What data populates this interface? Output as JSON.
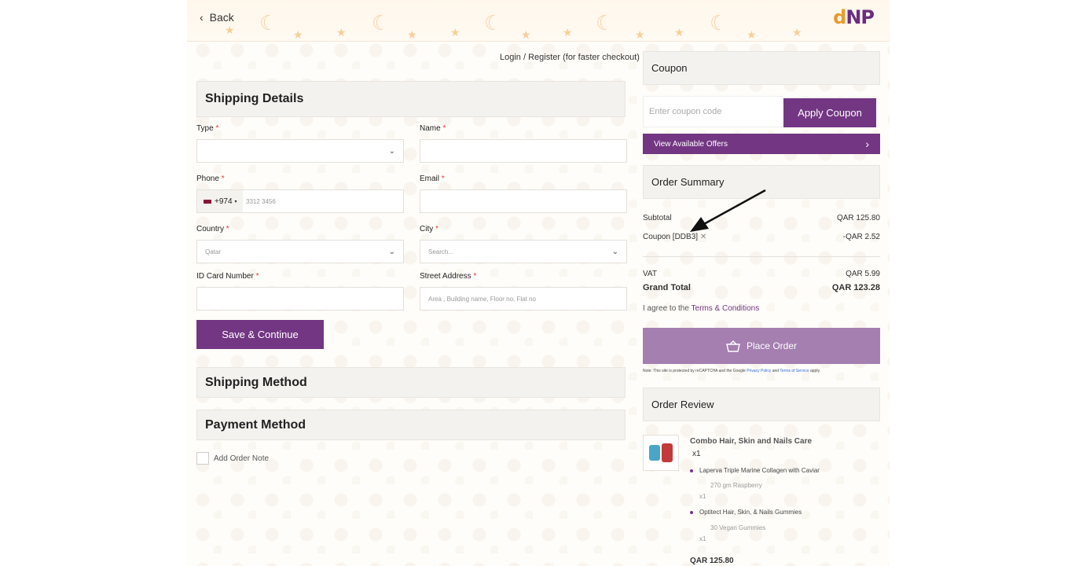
{
  "header": {
    "back_label": "Back",
    "logo_text": "dNP",
    "login_link": "Login / Register (for faster checkout)"
  },
  "shipping": {
    "title": "Shipping Details",
    "fields": {
      "type_label": "Type",
      "name_label": "Name",
      "phone_label": "Phone",
      "phone_code": "+974",
      "phone_placeholder": "3312 3456",
      "email_label": "Email",
      "country_label": "Country",
      "country_value": "Qatar",
      "city_label": "City",
      "city_placeholder": "Search...",
      "id_label": "ID Card Number",
      "street_label": "Street Address",
      "street_placeholder": "Area , Building name, Floor no, Flat no"
    },
    "required_mark": "*",
    "save_button": "Save & Continue"
  },
  "shipping_method_title": "Shipping Method",
  "payment_method_title": "Payment Method",
  "order_note_label": "Add Order Note",
  "coupon": {
    "title": "Coupon",
    "input_placeholder": "Enter coupon code",
    "apply_button": "Apply Coupon",
    "offers_label": "View Available Offers"
  },
  "summary": {
    "title": "Order Summary",
    "subtotal_label": "Subtotal",
    "subtotal_value": "QAR 125.80",
    "coupon_label": "Coupon [DDB3]",
    "coupon_value": "-QAR 2.52",
    "vat_label": "VAT",
    "vat_value": "QAR 5.99",
    "grand_total_label": "Grand Total",
    "grand_total_value": "QAR 123.28",
    "terms_prefix": "I agree to the",
    "terms_link": "Terms & Conditions",
    "place_order": "Place Order",
    "recaptcha_prefix": "Note: This site is protected by reCAPTCHA and the Google",
    "privacy_link": "Privacy Policy",
    "recaptcha_and": "and",
    "tos_link": "Terms of Service",
    "recaptcha_suffix": "apply."
  },
  "review": {
    "title": "Order Review",
    "product_name": "Combo Hair, Skin and Nails Care",
    "product_qty": "x1",
    "items": [
      {
        "name": "Laperva Triple Marine Collagen with Caviar",
        "variant": "270 gm Raspberry",
        "qty": "x1"
      },
      {
        "name": "Optitect Hair, Skin, & Nails Gummies",
        "variant": "30 Vegan Gummies",
        "qty": "x1"
      }
    ],
    "price": "QAR 125.80"
  },
  "colors": {
    "accent": "#733683",
    "place_order": "#a47fb0",
    "logo_orange": "#e89b2a"
  },
  "icons": [
    "chevron-left-icon",
    "chevron-down-icon",
    "chevron-right-icon",
    "basket-icon",
    "close-icon",
    "qatar-flag-icon"
  ]
}
